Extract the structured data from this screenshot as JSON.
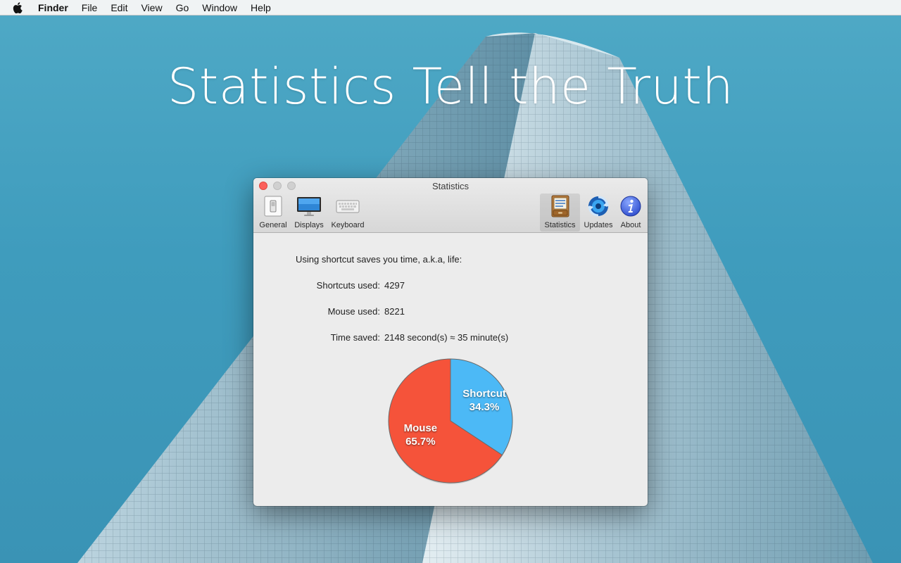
{
  "menubar": {
    "app_name": "Finder",
    "items": [
      "File",
      "Edit",
      "View",
      "Go",
      "Window",
      "Help"
    ]
  },
  "headline": "Statistics Tell the Truth",
  "window": {
    "title": "Statistics",
    "toolbar": {
      "left": [
        {
          "label": "General",
          "icon": "switch-icon"
        },
        {
          "label": "Displays",
          "icon": "display-icon"
        },
        {
          "label": "Keyboard",
          "icon": "keyboard-icon"
        }
      ],
      "right": [
        {
          "label": "Statistics",
          "icon": "drawer-icon",
          "selected": true
        },
        {
          "label": "Updates",
          "icon": "update-icon"
        },
        {
          "label": "About",
          "icon": "info-icon"
        }
      ]
    },
    "intro": "Using shortcut saves you time, a.k.a, life:",
    "stats": [
      {
        "label": "Shortcuts used:",
        "value": "4297"
      },
      {
        "label": "Mouse used:",
        "value": "8221"
      },
      {
        "label": "Time saved:",
        "value": "2148 second(s) ≈ 35 minute(s)"
      }
    ]
  },
  "colors": {
    "shortcut": "#4cb9f6",
    "mouse": "#f5533a",
    "close_button": "#fc605b"
  },
  "chart_data": {
    "type": "pie",
    "categories": [
      "Shortcut",
      "Mouse"
    ],
    "values": [
      34.3,
      65.7
    ],
    "labels": [
      "Shortcut\n34.3%",
      "Mouse\n65.7%"
    ],
    "percent_labels": [
      "34.3%",
      "65.7%"
    ]
  }
}
